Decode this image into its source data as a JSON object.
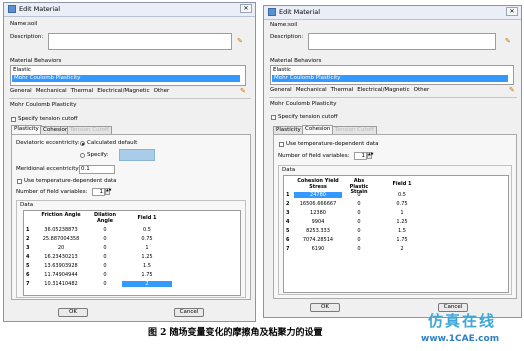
{
  "left_dialog": {
    "title": "Edit Material",
    "name_label": "Name:",
    "name_value": "soil",
    "description_label": "Description:",
    "behaviors_label": "Material Behaviors",
    "behaviors": [
      "Elastic",
      "Mohr Coulomb Plasticity"
    ],
    "menus": [
      "General",
      "Mechanical",
      "Thermal",
      "Electrical/Magnetic",
      "Other"
    ],
    "section_title": "Mohr Coulomb Plasticity",
    "tension_cutoff": "Specify tension cutoff",
    "tabs": [
      "Plasticity",
      "Cohesion",
      "Tension Cutoff"
    ],
    "deviatoric_label": "Deviatoric eccentricity:",
    "calc_default": "Calculated default",
    "specify": "Specify:",
    "meridional_label": "Meridional eccentricity:",
    "meridional_value": "0.1",
    "temp_dep": "Use temperature-dependent data",
    "field_vars_label": "Number of field variables:",
    "field_vars_value": "1",
    "data_label": "Data",
    "headers": [
      "Friction Angle",
      "Dilation Angle",
      "Field 1"
    ],
    "rows": [
      [
        "1",
        "36.05238873",
        "0",
        "0.5"
      ],
      [
        "2",
        "25.887004358",
        "0",
        "0.75"
      ],
      [
        "3",
        "20",
        "0",
        "1"
      ],
      [
        "4",
        "16.23430213",
        "0",
        "1.25"
      ],
      [
        "5",
        "13.63903928",
        "0",
        "1.5"
      ],
      [
        "6",
        "11.74904944",
        "0",
        "1.75"
      ],
      [
        "7",
        "10.31410482",
        "0",
        "2"
      ]
    ],
    "ok": "OK",
    "cancel": "Cancel"
  },
  "right_dialog": {
    "title": "Edit Material",
    "name_label": "Name:",
    "name_value": "soil",
    "description_label": "Description:",
    "behaviors_label": "Material Behaviors",
    "behaviors": [
      "Elastic",
      "Mohr Coulomb Plasticity"
    ],
    "menus": [
      "General",
      "Mechanical",
      "Thermal",
      "Electrical/Magnetic",
      "Other"
    ],
    "section_title": "Mohr Coulomb Plasticity",
    "tension_cutoff": "Specify tension cutoff",
    "tabs": [
      "Plasticity",
      "Cohesion",
      "Tension Cutoff"
    ],
    "temp_dep": "Use temperature-dependent data",
    "field_vars_label": "Number of field variables:",
    "field_vars_value": "1",
    "data_label": "Data",
    "headers": [
      "Cohesion Yield Stress",
      "Abs Plastic Strain",
      "Field 1"
    ],
    "rows": [
      [
        "1",
        "24780",
        "0",
        "0.5"
      ],
      [
        "2",
        "16506.666667",
        "0",
        "0.75"
      ],
      [
        "3",
        "12380",
        "0",
        "1"
      ],
      [
        "4",
        "9904",
        "0",
        "1.25"
      ],
      [
        "5",
        "8253.333",
        "0",
        "1.5"
      ],
      [
        "6",
        "7074.28514",
        "0",
        "1.75"
      ],
      [
        "7",
        "6190",
        "0",
        "2"
      ]
    ],
    "ok": "OK",
    "cancel": "Cancel"
  },
  "caption": "图 2  随场变量变化的摩擦角及粘聚力的设置",
  "watermark": {
    "line1": "仿真在线",
    "line2": "www.1CAE.com"
  },
  "colors": {
    "selection": "#3399ff",
    "window_bg": "#f0f0f0",
    "watermark": "#3fa7d8"
  }
}
